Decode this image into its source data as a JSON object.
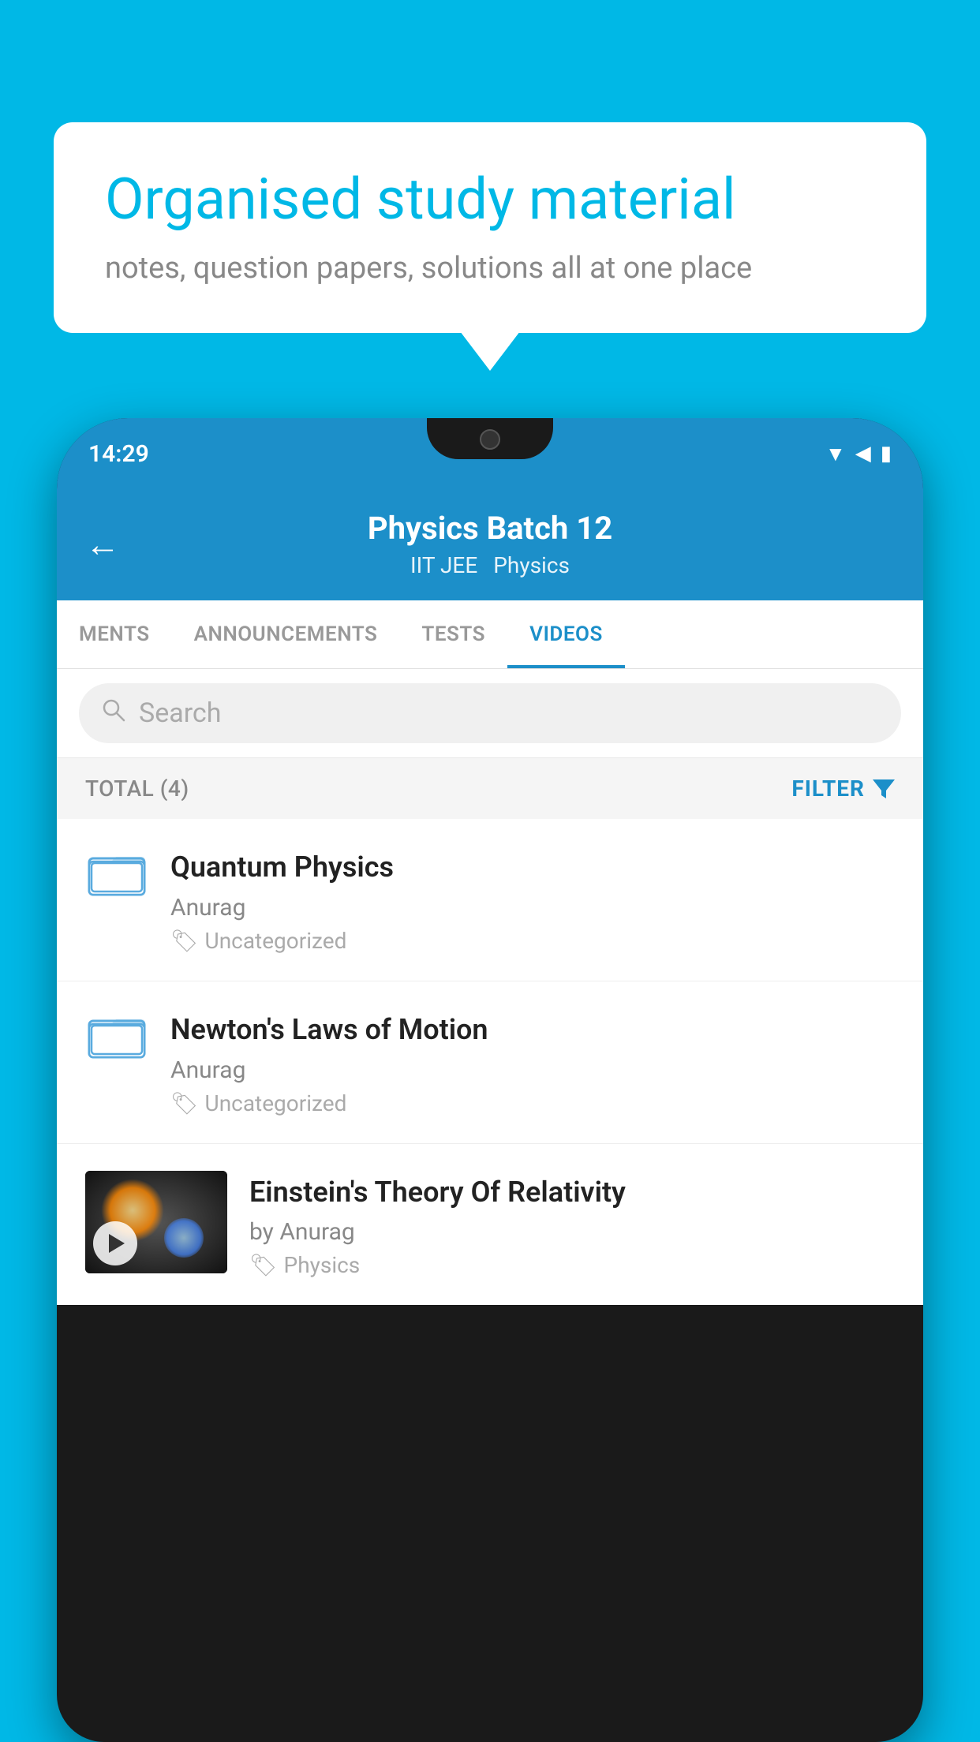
{
  "background_color": "#00b8e6",
  "speech_bubble": {
    "heading": "Organised study material",
    "subtext": "notes, question papers, solutions all at one place"
  },
  "status_bar": {
    "time": "14:29",
    "icons": [
      "wifi",
      "signal",
      "battery"
    ]
  },
  "app_header": {
    "back_label": "←",
    "title": "Physics Batch 12",
    "tags": [
      "IIT JEE",
      "Physics"
    ]
  },
  "tabs": [
    {
      "label": "MENTS",
      "active": false
    },
    {
      "label": "ANNOUNCEMENTS",
      "active": false
    },
    {
      "label": "TESTS",
      "active": false
    },
    {
      "label": "VIDEOS",
      "active": true
    }
  ],
  "search": {
    "placeholder": "Search"
  },
  "filter_bar": {
    "total_label": "TOTAL (4)",
    "filter_label": "FILTER"
  },
  "videos": [
    {
      "title": "Quantum Physics",
      "author": "Anurag",
      "tag": "Uncategorized",
      "type": "folder",
      "has_thumb": false
    },
    {
      "title": "Newton's Laws of Motion",
      "author": "Anurag",
      "tag": "Uncategorized",
      "type": "folder",
      "has_thumb": false
    },
    {
      "title": "Einstein's Theory Of Relativity",
      "author": "by Anurag",
      "tag": "Physics",
      "type": "video",
      "has_thumb": true
    }
  ]
}
